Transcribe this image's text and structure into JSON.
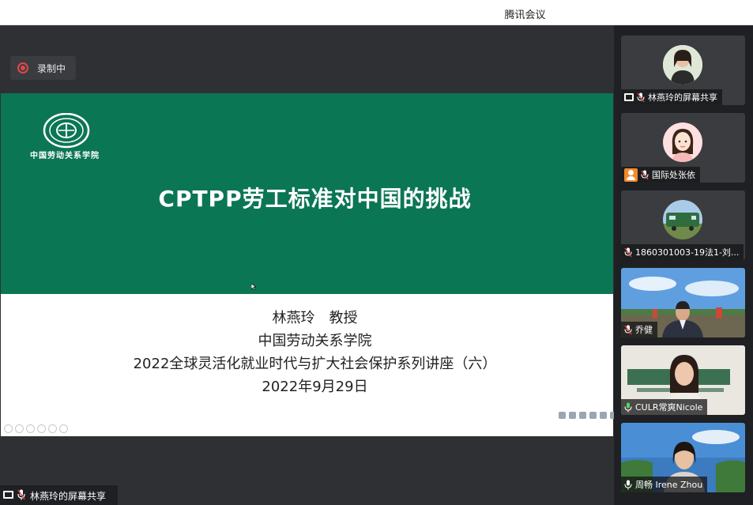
{
  "window": {
    "title": "腾讯会议"
  },
  "recording": {
    "label": "录制中",
    "color": "#e04848"
  },
  "slide": {
    "logo_text": "中国劳动关系学院",
    "heading": "CPTPP劳工标准对中国的挑战",
    "lines": [
      "林燕玲　教授",
      "中国劳动关系学院",
      "2022全球灵活化就业时代与扩大社会保护系列讲座（六）",
      "2022年9月29日"
    ],
    "band_color": "#0b7654"
  },
  "presenter_tag": {
    "label": "林燕玲的屏幕共享"
  },
  "participants": [
    {
      "name": "林燕玲的屏幕共享",
      "icon": "screen-share-icon"
    },
    {
      "name": "国际处张依",
      "icon": "user-icon"
    },
    {
      "name": "1860301003-19法1-刘...",
      "icon": "mic-muted-icon"
    },
    {
      "name": "乔健",
      "icon": "mic-muted-icon"
    },
    {
      "name": "CULR常爽Nicole",
      "icon": "mic-icon"
    },
    {
      "name": "周畅 Irene Zhou",
      "icon": "mic-icon"
    }
  ]
}
